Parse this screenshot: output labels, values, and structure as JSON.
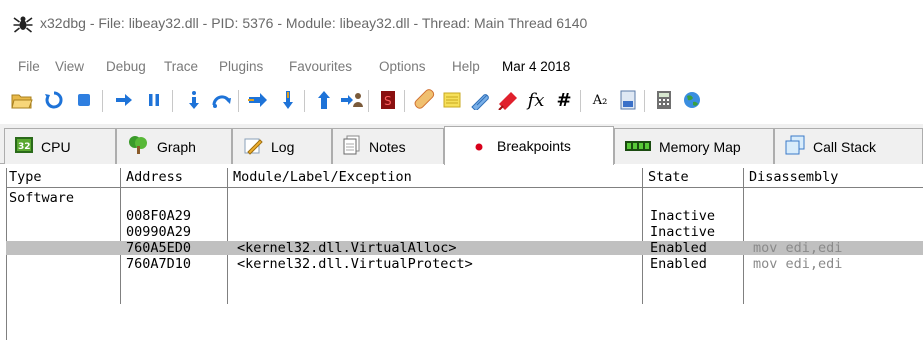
{
  "window": {
    "title": "x32dbg - File: libeay32.dll - PID: 5376 - Module: libeay32.dll - Thread: Main Thread 6140",
    "app_icon": "bug-icon"
  },
  "menu": {
    "items": [
      "File",
      "View",
      "Debug",
      "Trace",
      "Plugins",
      "Favourites",
      "Options",
      "Help"
    ],
    "date": "Mar 4 2018"
  },
  "toolbar": {
    "icons": [
      "open-icon",
      "restart-icon",
      "stop-icon",
      "run-icon",
      "pause-icon",
      "step-into-icon",
      "step-over-icon",
      "trace-into-icon",
      "trace-over-icon",
      "execute-till-return-icon",
      "run-to-user-code-icon",
      "scylla-icon",
      "patch-icon",
      "comments-icon",
      "labels-icon",
      "bookmarks-icon",
      "functions-icon",
      "hash-icon",
      "font-icon",
      "module-icon",
      "calculator-icon",
      "globe-icon"
    ],
    "fx_glyph": "fx",
    "hash_glyph": "#",
    "font_glyph": "A₂"
  },
  "tabs": [
    {
      "label": "CPU",
      "icon": "cpu-icon",
      "active": false
    },
    {
      "label": "Graph",
      "icon": "graph-icon",
      "active": false
    },
    {
      "label": "Log",
      "icon": "log-icon",
      "active": false
    },
    {
      "label": "Notes",
      "icon": "notes-icon",
      "active": false
    },
    {
      "label": "Breakpoints",
      "icon": "breakpoint-dot-icon",
      "active": true
    },
    {
      "label": "Memory Map",
      "icon": "memory-map-icon",
      "active": false
    },
    {
      "label": "Call Stack",
      "icon": "call-stack-icon",
      "active": false
    }
  ],
  "table": {
    "columns": [
      "Type",
      "Address",
      "Module/Label/Exception",
      "State",
      "Disassembly"
    ],
    "group_label": "Software",
    "rows": [
      {
        "address": "008F0A29",
        "label": "",
        "state": "Inactive",
        "disassembly": ""
      },
      {
        "address": "00990A29",
        "label": "",
        "state": "Inactive",
        "disassembly": ""
      },
      {
        "address": "760A5ED0",
        "label": "<kernel32.dll.VirtualAlloc>",
        "state": "Enabled",
        "disassembly": "mov edi,edi"
      },
      {
        "address": "760A7D10",
        "label": "<kernel32.dll.VirtualProtect>",
        "state": "Enabled",
        "disassembly": "mov edi,edi"
      }
    ],
    "selected_row": 2
  },
  "colors": {
    "selection": "#c0c0c0",
    "breakpoint_dot": "#d8001a",
    "menu_text": "#7a7a7a"
  }
}
